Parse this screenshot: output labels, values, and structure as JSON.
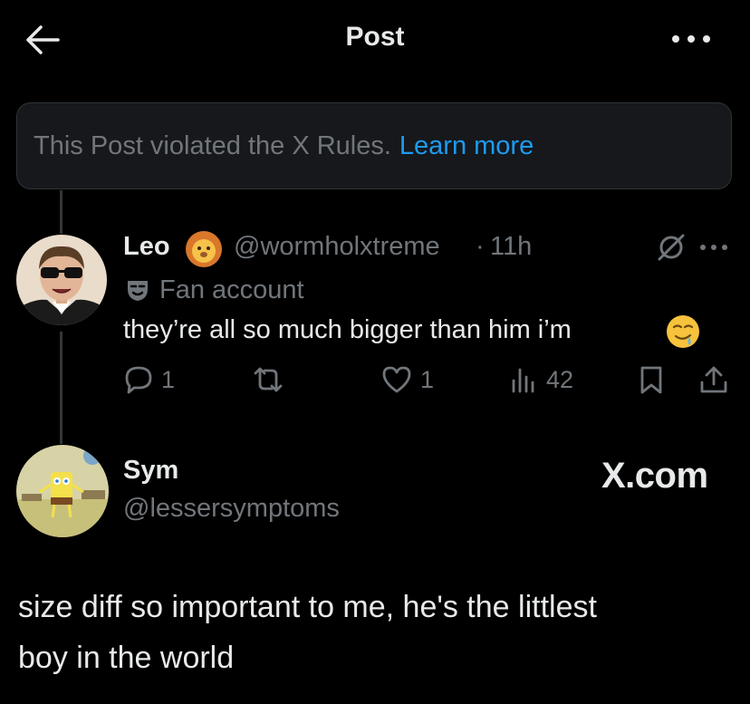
{
  "header": {
    "title": "Post"
  },
  "notice": {
    "text": "This Post violated the X Rules.",
    "link": "Learn more"
  },
  "reply": {
    "name": "Leo",
    "handle": "@wormholxtreme",
    "dot": "·",
    "time": "11h",
    "label": "Fan account",
    "text": "they’re all so much bigger than him i’m",
    "replies": "1",
    "likes": "1",
    "views": "42"
  },
  "quoted": {
    "name": "Sym",
    "handle": "@lessersymptoms",
    "watermark": "X.com",
    "text_line1": "size diff so important to me, he's the littlest",
    "text_line2": "boy in the world"
  },
  "colors": {
    "background": "#000000",
    "text": "#e7e9ea",
    "muted": "#71767b",
    "link": "#1d9bf0"
  }
}
